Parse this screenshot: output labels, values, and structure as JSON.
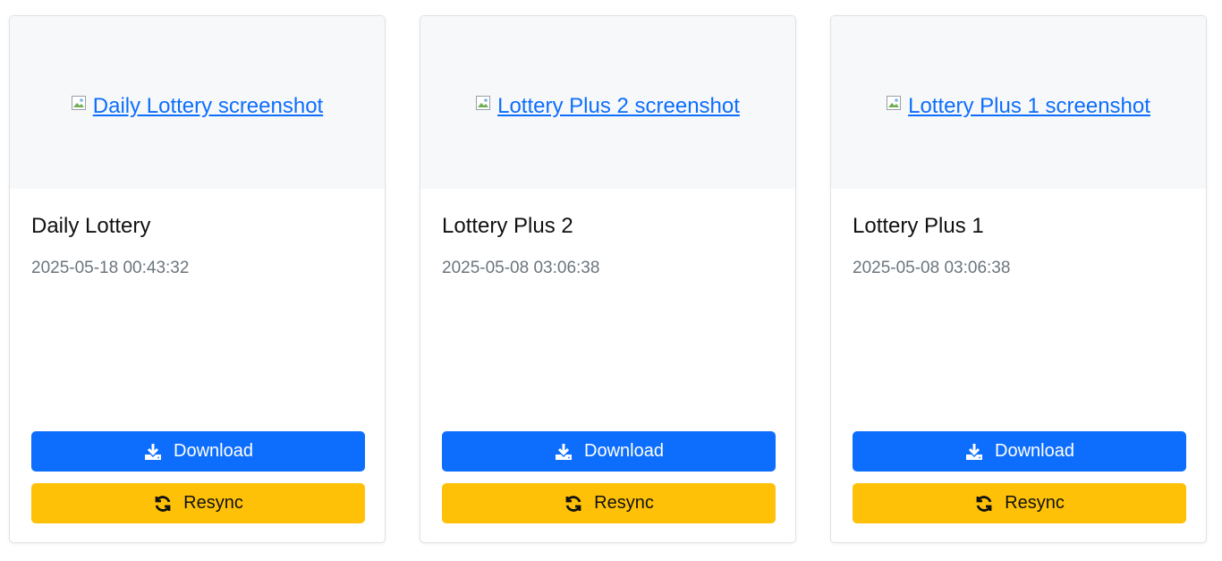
{
  "cards": [
    {
      "image_alt": "Daily Lottery screenshot",
      "title": "Daily Lottery",
      "timestamp": "2025-05-18 00:43:32",
      "download_label": "Download",
      "resync_label": "Resync"
    },
    {
      "image_alt": "Lottery Plus 2 screenshot",
      "title": "Lottery Plus 2",
      "timestamp": "2025-05-08 03:06:38",
      "download_label": "Download",
      "resync_label": "Resync"
    },
    {
      "image_alt": "Lottery Plus 1 screenshot",
      "title": "Lottery Plus 1",
      "timestamp": "2025-05-08 03:06:38",
      "download_label": "Download",
      "resync_label": "Resync"
    }
  ],
  "icons": {
    "download": "download-icon",
    "resync": "sync-icon",
    "broken_image": "broken-image-icon"
  },
  "colors": {
    "primary": "#0d6efd",
    "warning": "#ffc107",
    "muted": "#6c757d",
    "thumb_bg": "#f7f8fa"
  }
}
